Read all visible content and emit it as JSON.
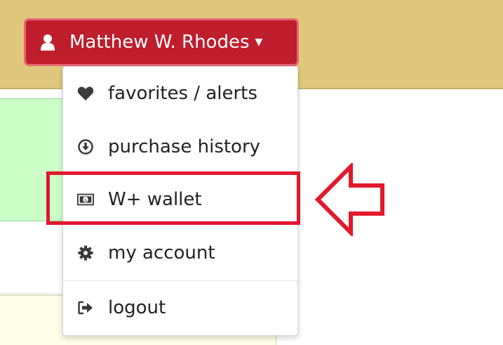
{
  "user_menu": {
    "user_name": "Matthew W. Rhodes",
    "items": [
      {
        "label": "favorites / alerts",
        "icon": "heart-icon"
      },
      {
        "label": "purchase history",
        "icon": "download-circle-icon"
      },
      {
        "label": "W+ wallet",
        "icon": "money-icon"
      },
      {
        "label": "my account",
        "icon": "gear-icon"
      },
      {
        "label": "logout",
        "icon": "sign-out-icon"
      }
    ]
  },
  "annotation": {
    "highlighted_item": "W+ wallet",
    "color": "#e3182d"
  },
  "colors": {
    "header_bar": "#dfc77c",
    "user_button": "#bf1e2d"
  }
}
